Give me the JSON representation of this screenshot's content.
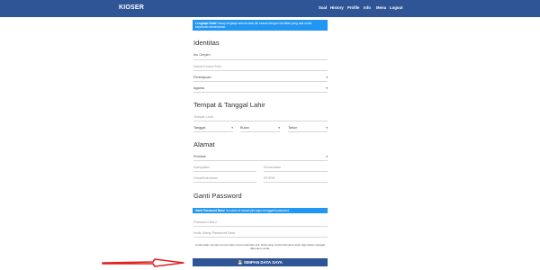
{
  "navbar": {
    "brand": "KIOSER",
    "items": [
      "Soal",
      "History",
      "Profile",
      "Info",
      "Menu",
      "Logout"
    ]
  },
  "alert_top": {
    "strong": "Lengkapi Data!",
    "text": "Harap lengkapi semua data diri sesuai dengan identitas yang ada untuk keperluan administrasi."
  },
  "identitas": {
    "title": "Identitas",
    "ibu_label": "Ibu Ompim",
    "nama_placeholder": "Nama Kontor/Toko",
    "jk_value": "Perempuan",
    "agama_value": "Agama"
  },
  "ttl": {
    "title": "Tempat & Tanggal Lahir",
    "tempat_placeholder": "Tempat Lahir",
    "tanggal": "Tanggal",
    "bulan": "Bulan",
    "tahun": "Tahun"
  },
  "alamat": {
    "title": "Alamat",
    "provinsi": "Provinsi",
    "kabupaten": "Kabupaten",
    "kecamatan": "Kecamatan",
    "desa": "Desa/Kelurahan",
    "rtrw": "RT/RW"
  },
  "password": {
    "title": "Ganti Password",
    "alert_strong": "Ganti Password Baru!",
    "alert_text": "Isi kolom di bawah jika ingin mengganti password.",
    "baru_placeholder": "Password Baru",
    "ulang_placeholder": "Ketik Ulang Password Baru"
  },
  "note": "Anda wajib mengisi semua data sesuai identitas asli. Data yang sudah disimpan akan digunakan sebagai data akun anda.",
  "save_label": "SIMPAN DATA SAYA",
  "colors": {
    "primary": "#2f5597",
    "info": "#2196f3",
    "arrow": "#e02020"
  }
}
